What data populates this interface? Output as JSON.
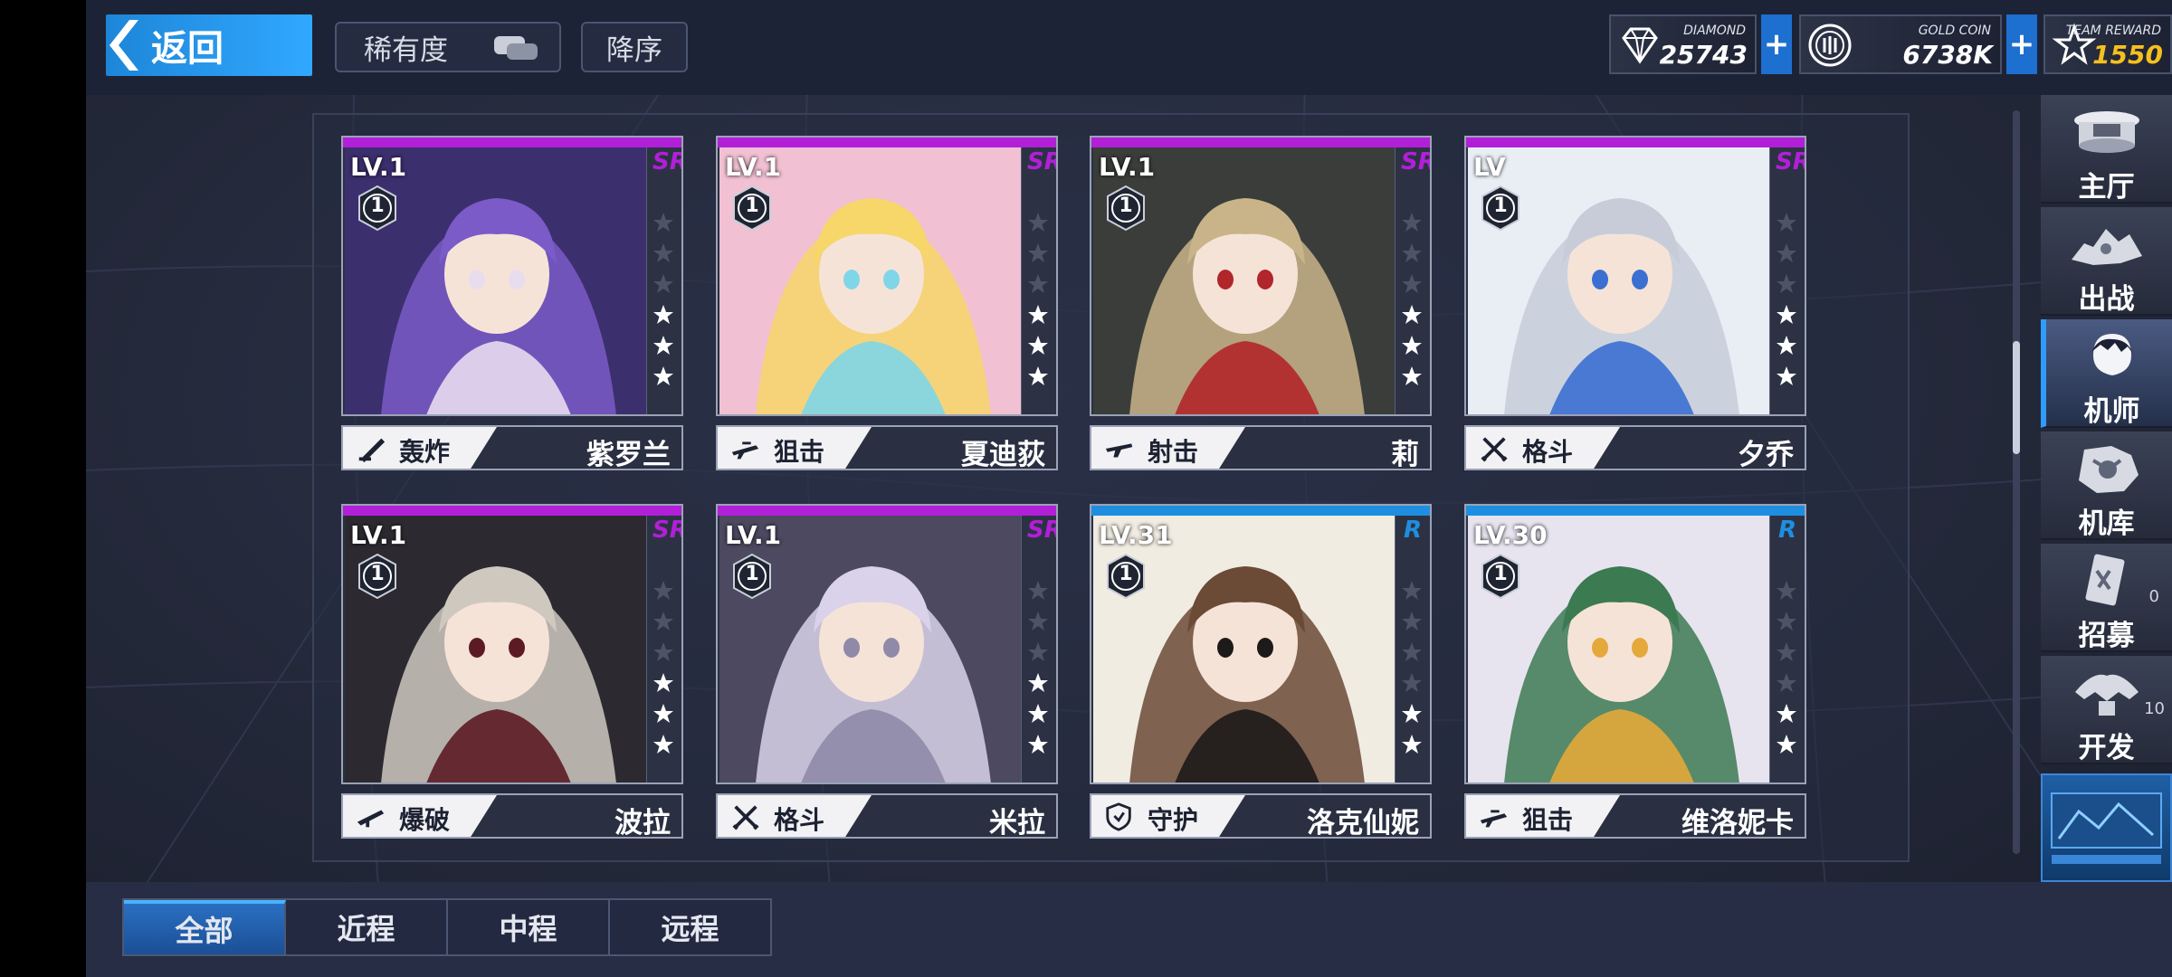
{
  "header": {
    "back_label": "返回",
    "rarity_sort_label": "稀有度",
    "order_label": "降序"
  },
  "currencies": [
    {
      "name": "DIAMOND",
      "value": "25743",
      "icon": "diamond-icon",
      "value_color": "#ffffff"
    },
    {
      "name": "GOLD COIN",
      "value": "6738K",
      "icon": "gold-coin-icon",
      "value_color": "#ffffff"
    },
    {
      "name": "TEAM REWARD",
      "value": "1550",
      "icon": "star-badge-icon",
      "value_color": "#f5c01e"
    }
  ],
  "colors": {
    "accent": "#2f9bff",
    "sr": "#b21fd8",
    "r": "#1e8fe0"
  },
  "pilots": [
    {
      "level": "LV.1",
      "rank": "1",
      "rarity": "SR",
      "class": "轰炸",
      "class_icon": "mortar-icon",
      "name": "紫罗兰",
      "stars": 3
    },
    {
      "level": "LV.1",
      "rank": "1",
      "rarity": "SR",
      "class": "狙击",
      "class_icon": "sniper-rifle-icon",
      "name": "夏迪荻",
      "stars": 3
    },
    {
      "level": "LV.1",
      "rank": "1",
      "rarity": "SR",
      "class": "射击",
      "class_icon": "assault-rifle-icon",
      "name": "莉",
      "stars": 3
    },
    {
      "level": "LV",
      "rank": "1",
      "rarity": "SR",
      "class": "格斗",
      "class_icon": "crossed-swords-icon",
      "name": "夕乔",
      "stars": 3
    },
    {
      "level": "LV.1",
      "rank": "1",
      "rarity": "SR",
      "class": "爆破",
      "class_icon": "rocket-launcher-icon",
      "name": "波拉",
      "stars": 3
    },
    {
      "level": "LV.1",
      "rank": "1",
      "rarity": "SR",
      "class": "格斗",
      "class_icon": "crossed-swords-icon",
      "name": "米拉",
      "stars": 3
    },
    {
      "level": "LV.31",
      "rank": "1",
      "rarity": "R",
      "class": "守护",
      "class_icon": "shield-icon",
      "name": "洛克仙妮",
      "stars": 2
    },
    {
      "level": "LV.30",
      "rank": "1",
      "rarity": "R",
      "class": "狙击",
      "class_icon": "sniper-rifle-icon",
      "name": "维洛妮卡",
      "stars": 2
    }
  ],
  "side_nav": [
    {
      "label": "主厅",
      "icon": "hall-icon"
    },
    {
      "label": "出战",
      "icon": "battle-icon"
    },
    {
      "label": "机师",
      "icon": "pilot-icon",
      "active": true
    },
    {
      "label": "机库",
      "icon": "hangar-icon"
    },
    {
      "label": "招募",
      "icon": "recruit-card-icon",
      "count": "0"
    },
    {
      "label": "开发",
      "icon": "develop-icon",
      "count": "10"
    }
  ],
  "tabs": [
    {
      "label": "全部",
      "active": true
    },
    {
      "label": "近程"
    },
    {
      "label": "中程"
    },
    {
      "label": "远程"
    }
  ]
}
